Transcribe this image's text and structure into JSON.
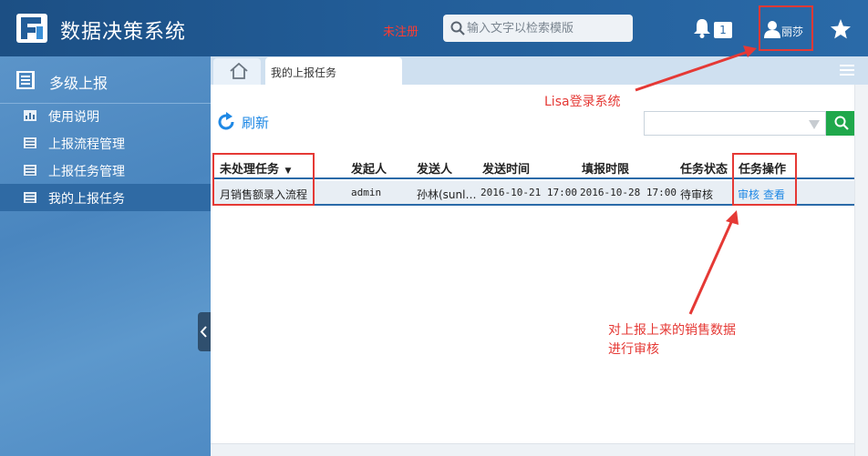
{
  "header": {
    "app_title": "数据决策系统",
    "unregistered_label": "未注册",
    "search_placeholder": "输入文字以检索模版",
    "notification_count": "1",
    "user_name": "丽莎"
  },
  "sidebar": {
    "section_title": "多级上报",
    "items": [
      {
        "label": "使用说明",
        "icon": "chart-icon",
        "active": false
      },
      {
        "label": "上报流程管理",
        "icon": "list-icon",
        "active": false
      },
      {
        "label": "上报任务管理",
        "icon": "list-icon",
        "active": false
      },
      {
        "label": "我的上报任务",
        "icon": "list-icon",
        "active": true
      }
    ]
  },
  "tabs": {
    "active_label": "我的上报任务"
  },
  "toolbar": {
    "refresh_label": "刷新"
  },
  "table": {
    "columns": [
      "未处理任务",
      "发起人",
      "发送人",
      "发送时间",
      "填报时限",
      "任务状态",
      "任务操作"
    ],
    "rows": [
      {
        "task": "月销售额录入流程",
        "initiator": "admin",
        "sender": "孙林(sunl…",
        "send_time": "2016-10-21 17:00",
        "deadline": "2016-10-28 17:00",
        "status": "待审核",
        "action_review": "审核",
        "action_view": "查看"
      }
    ]
  },
  "annotations": {
    "login_note": "Lisa登录系统",
    "review_note_line1": "对上报上来的销售数据",
    "review_note_line2": "进行审核"
  },
  "colors": {
    "accent_red": "#e53935",
    "header_blue": "#225d98",
    "link_blue": "#1e88e5",
    "search_green": "#1fa84b"
  }
}
